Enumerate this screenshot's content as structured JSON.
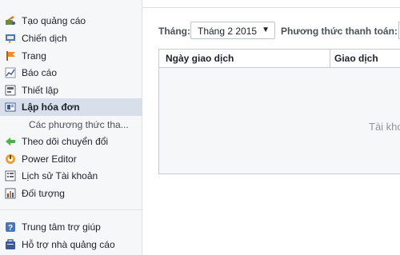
{
  "sidebar": {
    "items": [
      {
        "label": "Tạo quảng cáo",
        "icon": "create-ad-icon"
      },
      {
        "label": "Chiến dịch",
        "icon": "campaign-icon"
      },
      {
        "label": "Trang",
        "icon": "page-flag-icon"
      },
      {
        "label": "Báo cáo",
        "icon": "report-chart-icon"
      },
      {
        "label": "Thiết lập",
        "icon": "settings-icon"
      },
      {
        "label": "Lập hóa đơn",
        "icon": "billing-icon",
        "active": true
      },
      {
        "label": "Các phương thức tha..."
      },
      {
        "label": "Theo dõi chuyển đổi",
        "icon": "conversion-tracking-icon"
      },
      {
        "label": "Power Editor",
        "icon": "power-editor-icon"
      },
      {
        "label": "Lịch sử Tài khoản",
        "icon": "account-history-icon"
      },
      {
        "label": "Đối tượng",
        "icon": "audience-icon"
      }
    ],
    "bottom_items": [
      {
        "label": "Trung tâm trợ giúp",
        "icon": "help-center-icon"
      },
      {
        "label": "Hỗ trợ nhà quảng cáo",
        "icon": "advertiser-support-icon"
      }
    ]
  },
  "filters": {
    "month_label": "Tháng:",
    "month_value": "Tháng 2 2015",
    "payment_label": "Phương thức thanh toán:"
  },
  "table": {
    "columns": [
      "Ngày giao dịch",
      "Giao dịch"
    ],
    "empty_text": "Tài kho"
  },
  "colors": {
    "active_bg": "#d8dfea",
    "sidebar_bg": "#f6f7f9",
    "table_border": "#c7cbd1"
  }
}
